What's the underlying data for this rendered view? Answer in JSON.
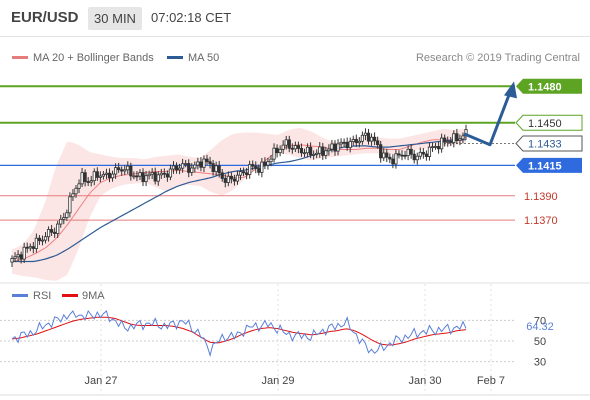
{
  "header": {
    "symbol": "EUR/USD",
    "timeframe": "30 MIN",
    "time": "07:02:18 CET"
  },
  "legend": {
    "ma20_bb": "MA 20 + Bollinger Bands",
    "ma50": "MA 50",
    "credit": "Research © 2019 Trading Central",
    "rsi": "RSI",
    "ma9": "9MA"
  },
  "colors": {
    "green": "#5da423",
    "blue": "#2f6bde",
    "red": "#e67c7c",
    "candle": "#333333",
    "bollinger_fill": "#fbdcdc",
    "ma20": "#f08080",
    "ma50": "#2c5c96",
    "rsi": "#5a7fd8",
    "rsi_ma": "#e01010"
  },
  "chart_data": [
    {
      "type": "candlestick",
      "ylim": [
        1.132,
        1.1495
      ],
      "x_ticks": [
        "Jan 27",
        "Jan 29",
        "Jan 30",
        "Feb 7"
      ],
      "levels": [
        {
          "value": 1.148,
          "label": "1.1480",
          "color": "green",
          "style": "filled"
        },
        {
          "value": 1.145,
          "label": "1.1450",
          "color": "green",
          "style": "outline"
        },
        {
          "value": 1.1433,
          "label": "1.1433",
          "color": "dark",
          "style": "outline"
        },
        {
          "value": 1.1415,
          "label": "1.1415",
          "color": "blue",
          "style": "filled"
        },
        {
          "value": 1.139,
          "label": "1.1390",
          "color": "red",
          "style": "plain"
        },
        {
          "value": 1.137,
          "label": "1.1370",
          "color": "red",
          "style": "plain"
        }
      ],
      "close_path": [
        1.1337,
        1.1342,
        1.1348,
        1.1352,
        1.1358,
        1.1362,
        1.1372,
        1.139,
        1.1405,
        1.1402,
        1.1408,
        1.1406,
        1.141,
        1.1413,
        1.1408,
        1.1405,
        1.1407,
        1.1406,
        1.1408,
        1.1413,
        1.1415,
        1.1412,
        1.1418,
        1.1417,
        1.141,
        1.1402,
        1.1405,
        1.1409,
        1.1414,
        1.1412,
        1.142,
        1.1428,
        1.1433,
        1.1429,
        1.1427,
        1.1425,
        1.1426,
        1.1428,
        1.1432,
        1.1433,
        1.1434,
        1.1439,
        1.1438,
        1.1426,
        1.1419,
        1.1422,
        1.1426,
        1.1422,
        1.1424,
        1.1429,
        1.1433,
        1.1436,
        1.1437,
        1.1441
      ],
      "forecast": [
        1.1441,
        1.1432,
        1.1475
      ],
      "bollinger": {
        "mid": [
          1.1336,
          1.1338,
          1.1342,
          1.1347,
          1.1355,
          1.1366,
          1.1379,
          1.1392,
          1.1401,
          1.1405,
          1.1407,
          1.1408,
          1.1409,
          1.141,
          1.141,
          1.1411,
          1.141,
          1.1409,
          1.1408,
          1.1407,
          1.1405,
          1.1405,
          1.1412,
          1.142,
          1.1427,
          1.1431,
          1.1432,
          1.1431,
          1.143,
          1.1428,
          1.1428,
          1.1428,
          1.1429,
          1.1429,
          1.1428,
          1.1428,
          1.1431,
          1.1434,
          1.1436,
          1.1436,
          1.1436,
          1.1438
        ],
        "upper": [
          1.1346,
          1.135,
          1.1362,
          1.1385,
          1.1415,
          1.1435,
          1.1432,
          1.1426,
          1.1424,
          1.1422,
          1.1421,
          1.1421,
          1.142,
          1.1422,
          1.1423,
          1.1424,
          1.1422,
          1.1421,
          1.1428,
          1.1436,
          1.1441,
          1.1442,
          1.1442,
          1.1441,
          1.144,
          1.1444,
          1.1446,
          1.1443,
          1.1438,
          1.1434,
          1.1434,
          1.1438,
          1.1439,
          1.1438,
          1.1437,
          1.1437,
          1.1439,
          1.1441,
          1.1443,
          1.1445,
          1.1444,
          1.1445
        ],
        "lower": [
          1.1326,
          1.1324,
          1.1323,
          1.1321,
          1.132,
          1.1325,
          1.1346,
          1.1372,
          1.139,
          1.1396,
          1.1399,
          1.14,
          1.1401,
          1.1397,
          1.1393,
          1.1398,
          1.1399,
          1.1398,
          1.1393,
          1.139,
          1.1395,
          1.1404,
          1.1412,
          1.1418,
          1.1425,
          1.1424,
          1.1421,
          1.1419,
          1.1421,
          1.1422,
          1.1423,
          1.1424,
          1.1425,
          1.1425,
          1.1424,
          1.1425,
          1.1427,
          1.1428,
          1.143,
          1.1431,
          1.1432,
          1.1433
        ]
      },
      "ma50": [
        1.1336,
        1.1336,
        1.1336,
        1.1338,
        1.1341,
        1.1346,
        1.1352,
        1.1358,
        1.1364,
        1.1369,
        1.1374,
        1.1379,
        1.1384,
        1.1389,
        1.1394,
        1.1398,
        1.1401,
        1.1403,
        1.1405,
        1.1408,
        1.141,
        1.1411,
        1.1413,
        1.1415,
        1.1417,
        1.1418,
        1.142,
        1.1423,
        1.1426,
        1.1428,
        1.143,
        1.1431,
        1.1431,
        1.143,
        1.143,
        1.1431,
        1.1432,
        1.1433,
        1.1434,
        1.1435,
        1.1436,
        1.1436
      ]
    },
    {
      "type": "line",
      "name": "RSI",
      "ylim": [
        20,
        80
      ],
      "y_ticks": [
        30,
        50,
        70
      ],
      "last_value": "64.32",
      "rsi": [
        52,
        55,
        57,
        61,
        66,
        69,
        73,
        77,
        75,
        74,
        76,
        75,
        70,
        63,
        64,
        66,
        67,
        66,
        64,
        67,
        69,
        63,
        56,
        41,
        49,
        55,
        54,
        60,
        64,
        65,
        66,
        62,
        57,
        55,
        55,
        54,
        59,
        62,
        65,
        68,
        58,
        47,
        40,
        42,
        47,
        51,
        54,
        57,
        59,
        60,
        61,
        62,
        63,
        64
      ],
      "ma9": [
        52,
        53,
        55,
        57,
        60,
        63,
        66,
        69,
        71,
        72,
        73,
        73,
        72,
        69,
        66,
        65,
        65,
        65,
        65,
        64,
        62,
        59,
        54,
        49,
        48,
        50,
        53,
        57,
        60,
        62,
        63,
        62,
        60,
        58,
        57,
        56,
        57,
        59,
        60,
        62,
        60,
        56,
        51,
        47,
        46,
        47,
        49,
        52,
        54,
        56,
        57,
        58,
        60,
        61
      ]
    }
  ]
}
